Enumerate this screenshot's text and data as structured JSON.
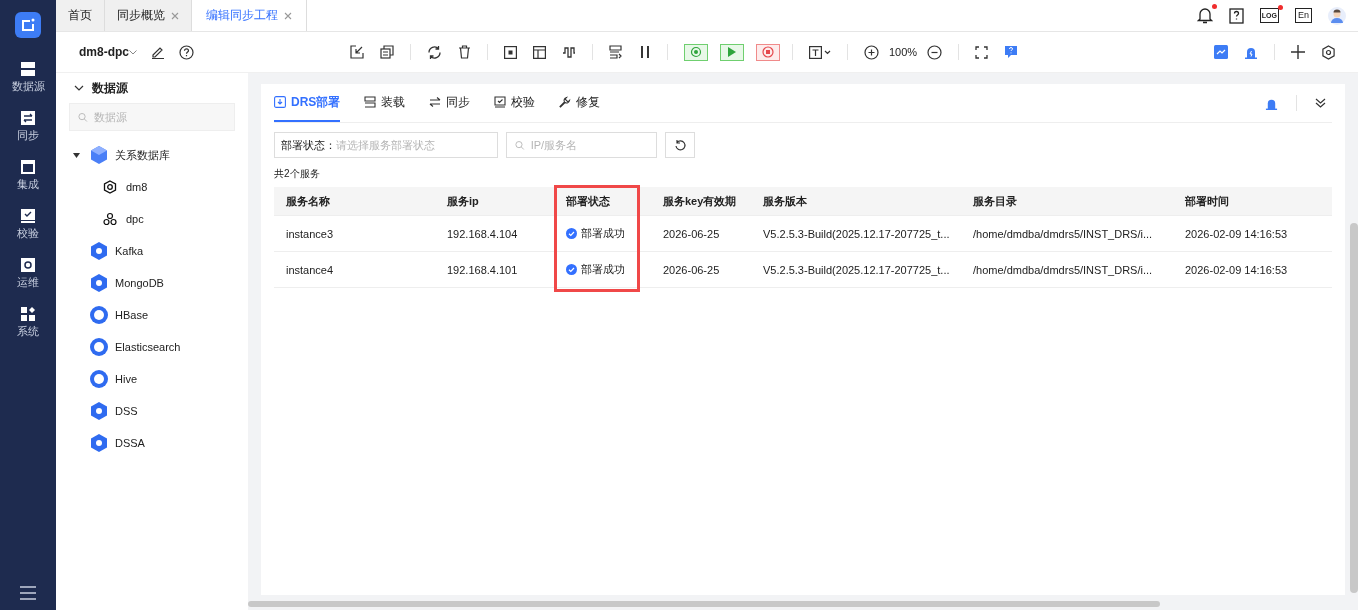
{
  "nav": [
    {
      "label": "数据源"
    },
    {
      "label": "同步"
    },
    {
      "label": "集成"
    },
    {
      "label": "校验"
    },
    {
      "label": "运维"
    },
    {
      "label": "系统"
    }
  ],
  "tabs": [
    {
      "label": "首页",
      "closable": false,
      "selected": false
    },
    {
      "label": "同步概览",
      "closable": true,
      "selected": false
    },
    {
      "label": "编辑同步工程",
      "closable": true,
      "selected": true
    }
  ],
  "top_right": {
    "notification_dot": true,
    "log_label": "LOG",
    "log_dot": true,
    "language": "En"
  },
  "project": {
    "name": "dm8-dpc"
  },
  "zoom": "100%",
  "tree": {
    "title": "数据源",
    "expanded": true,
    "search_placeholder": "数据源",
    "items": [
      {
        "label": "关系数据库",
        "expanded": true,
        "children": [
          {
            "label": "dm8"
          },
          {
            "label": "dpc"
          }
        ]
      },
      {
        "label": "Kafka"
      },
      {
        "label": "MongoDB"
      },
      {
        "label": "HBase"
      },
      {
        "label": "Elasticsearch"
      },
      {
        "label": "Hive"
      },
      {
        "label": "DSS"
      },
      {
        "label": "DSSA"
      }
    ]
  },
  "panel_tabs": [
    {
      "label": "DRS部署",
      "selected": true
    },
    {
      "label": "装载",
      "selected": false
    },
    {
      "label": "同步",
      "selected": false
    },
    {
      "label": "校验",
      "selected": false
    },
    {
      "label": "修复",
      "selected": false
    }
  ],
  "filters": {
    "status_label": "部署状态：",
    "status_placeholder": "请选择服务部署状态",
    "search_placeholder": "IP/服务名"
  },
  "count": "共2个服务",
  "table": {
    "columns": [
      {
        "label": "服务名称",
        "highlighted": false
      },
      {
        "label": "服务ip",
        "highlighted": false
      },
      {
        "label": "部署状态",
        "highlighted": true
      },
      {
        "label": "服务key有效期",
        "highlighted": false
      },
      {
        "label": "服务版本",
        "highlighted": false
      },
      {
        "label": "服务目录",
        "highlighted": false
      },
      {
        "label": "部署时间",
        "highlighted": false
      }
    ],
    "rows": [
      {
        "name": "instance3",
        "ip": "192.168.4.104",
        "status": {
          "text": "部署成功",
          "kind": "success"
        },
        "key_expiry": "2026-06-25",
        "version": "V5.2.5.3-Build(2025.12.17-207725_t...",
        "directory": "/home/dmdba/dmdrs5/INST_DRS/i...",
        "deployed_at": "2026-02-09 14:16:53"
      },
      {
        "name": "instance4",
        "ip": "192.168.4.101",
        "status": {
          "text": "部署成功",
          "kind": "success"
        },
        "key_expiry": "2026-06-25",
        "version": "V5.2.5.3-Build(2025.12.17-207725_t...",
        "directory": "/home/dmdba/dmdrs5/INST_DRS/i...",
        "deployed_at": "2026-02-09 14:16:53"
      }
    ]
  }
}
